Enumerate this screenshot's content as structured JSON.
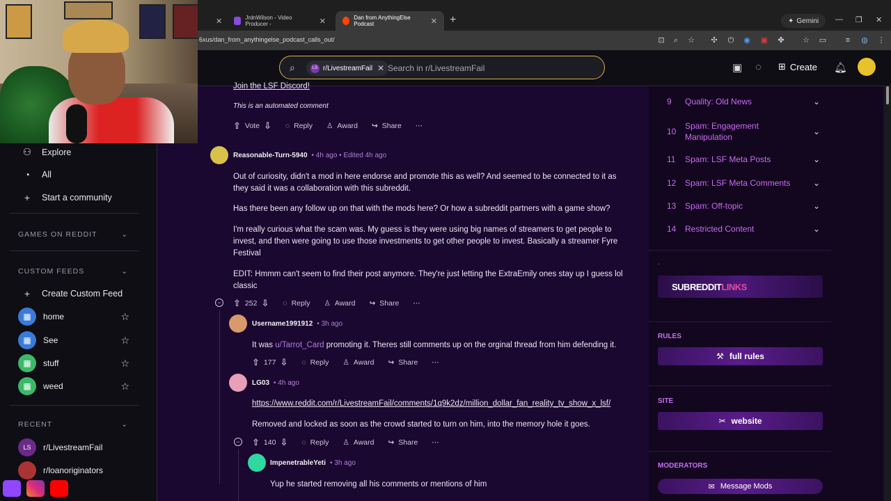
{
  "browser": {
    "tabs": [
      {
        "label": "",
        "color": "#4a4a4a"
      },
      {
        "label": "JrdnWilson - Video Producer -",
        "color": "#8a4be0"
      },
      {
        "label": "Dan from AnythingElse Podcast",
        "color": "#ff4500"
      }
    ],
    "gemini_label": "Gemini",
    "url": "6xus/dan_from_anythingelse_podcast_calls_out/"
  },
  "header": {
    "search_chip": "r/LivestreamFail",
    "search_placeholder": "Search in r/LivestreamFail",
    "create_label": "Create"
  },
  "sidebar": {
    "nav": [
      {
        "label": "Explore",
        "icon": "explore-icon",
        "glyph": "⚇"
      },
      {
        "label": "All",
        "icon": "all-icon",
        "glyph": "◔"
      },
      {
        "label": "Start a community",
        "icon": "plus-icon",
        "glyph": "+"
      }
    ],
    "games_title": "GAMES ON REDDIT",
    "custom_feeds_title": "CUSTOM FEEDS",
    "create_feed_label": "Create Custom Feed",
    "feeds": [
      {
        "label": "home",
        "color": "#3a7ad8"
      },
      {
        "label": "See",
        "color": "#3a7ad8"
      },
      {
        "label": "stuff",
        "color": "#3cb86a"
      },
      {
        "label": "weed",
        "color": "#3cb86a"
      }
    ],
    "recent_title": "RECENT",
    "recent": [
      {
        "label": "r/LivestreamFail",
        "badge": "LS"
      },
      {
        "label": "r/loanoriginators",
        "badge": ""
      }
    ]
  },
  "comments": {
    "top": {
      "link_text": "Join the LSF Discord!",
      "auto_note": "This is an automated comment",
      "vote_label": "Vote",
      "reply": "Reply",
      "award": "Award",
      "share": "Share"
    },
    "c1": {
      "user": "Reasonable-Turn-5940",
      "time": "• 4h ago • Edited 4h ago",
      "p1": "Out of curiosity, didn't a mod in here endorse and promote this as well? And seemed to be connected to it as they said it was a collaboration with this subreddit.",
      "p2": "Has there been any follow up on that with the mods here? Or how a subreddit partners with a game show?",
      "p3": "I'm really curious what the scam was. My guess is they were using big names of streamers to get people to invest, and then were going to use those investments to get other people to invest. Basically a streamer Fyre Festival",
      "p4": "EDIT: Hmmm can't seem to find their post anymore. They're just letting the ExtraEmily ones stay up I guess lol classic",
      "votes": "252"
    },
    "c2": {
      "user": "Username1991912",
      "time": "• 3h ago",
      "pre": "It was ",
      "mention": "u/Tarrot_Card",
      "post": " promoting it. Theres still comments up on the orginal thread from him defending it.",
      "votes": "177"
    },
    "c3": {
      "user": "LG03",
      "time": "• 4h ago",
      "url": "https://www.reddit.com/r/LivestreamFail/comments/1q9k2dz/million_dollar_fan_reality_tv_show_x_lsf/",
      "body": "Removed and locked as soon as the crowd started to turn on him, into the memory hole it goes.",
      "votes": "140"
    },
    "c4": {
      "user": "ImpenetrableYeti",
      "time": "• 3h ago",
      "body": "Yup he started removing all his comments or mentions of him"
    }
  },
  "rightbar": {
    "rules": [
      {
        "n": "9",
        "label": "Quality: Old News"
      },
      {
        "n": "10",
        "label": "Spam: Engagement Manipulation"
      },
      {
        "n": "11",
        "label": "Spam: LSF Meta Posts"
      },
      {
        "n": "12",
        "label": "Spam: LSF Meta Comments"
      },
      {
        "n": "13",
        "label": "Spam: Off-topic"
      },
      {
        "n": "14",
        "label": "Restricted Content"
      }
    ],
    "dot": ".",
    "banner_white": "SUBREDDIT",
    "banner_pink": "LINKS",
    "rules_title": "RULES",
    "full_rules": "full rules",
    "site_title": "SITE",
    "website": "website",
    "mods_title": "MODERATORS",
    "message_mods": "Message Mods"
  }
}
